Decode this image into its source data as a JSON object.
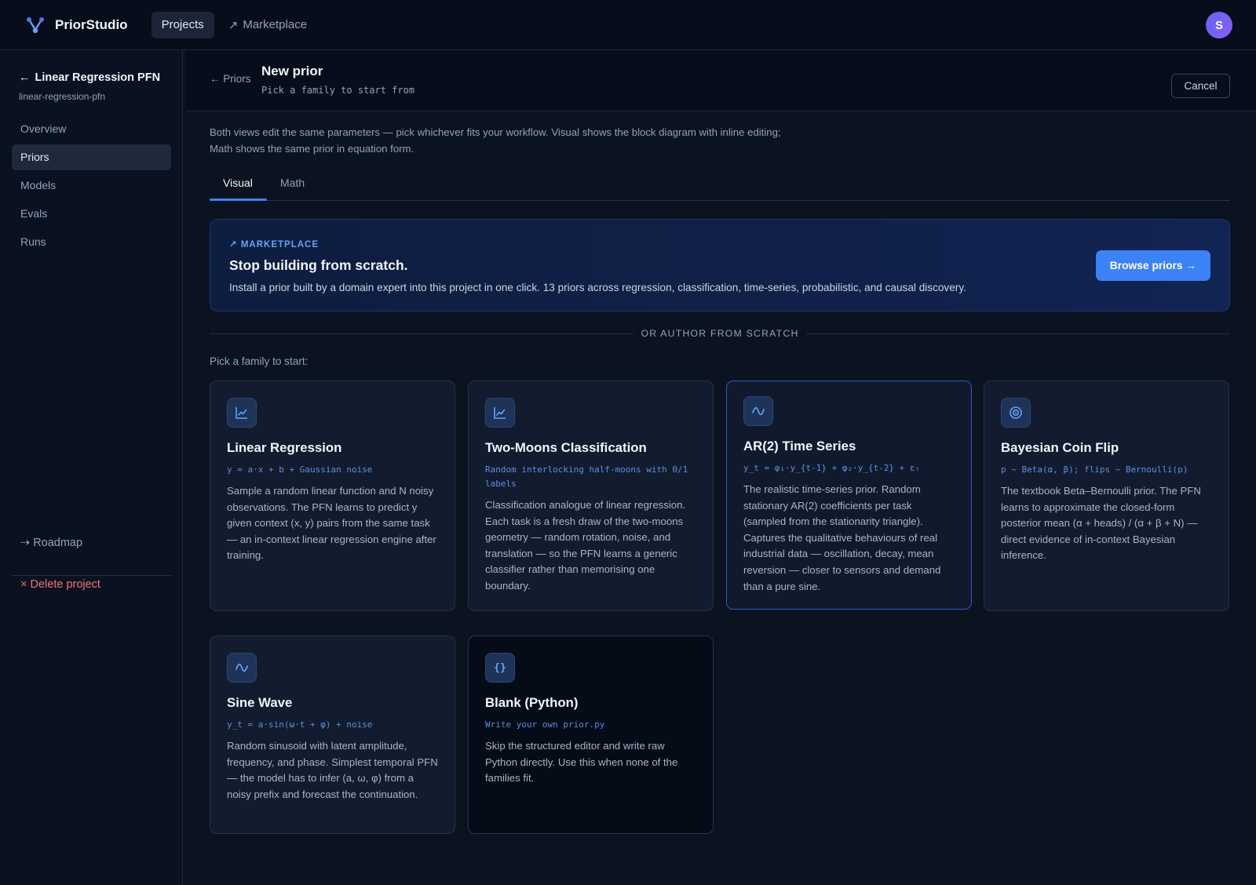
{
  "app": {
    "name": "PriorStudio",
    "nav": {
      "projects": "Projects",
      "marketplace": "Marketplace"
    },
    "user_initial": "S"
  },
  "sidebar": {
    "project_title": "Linear Regression PFN",
    "project_slug": "linear-regression-pfn",
    "items": [
      {
        "label": "Overview"
      },
      {
        "label": "Priors"
      },
      {
        "label": "Models"
      },
      {
        "label": "Evals"
      },
      {
        "label": "Runs"
      }
    ],
    "roadmap": "Roadmap",
    "delete": "Delete project"
  },
  "header": {
    "back": "Priors",
    "title": "New prior",
    "subtitle": "Pick a family to start from",
    "cancel": "Cancel"
  },
  "intro": "Both views edit the same parameters — pick whichever fits your workflow. Visual shows the block diagram with inline editing; Math shows the same prior in equation form.",
  "tabs": [
    {
      "label": "Visual"
    },
    {
      "label": "Math"
    }
  ],
  "marketplace": {
    "kicker": "MARKETPLACE",
    "title": "Stop building from scratch.",
    "description": "Install a prior built by a domain expert into this project in one click. 13 priors across regression, classification, time-series, probabilistic, and causal discovery.",
    "button": "Browse priors →"
  },
  "divider_text": "OR AUTHOR FROM SCRATCH",
  "pick_label": "Pick a family to start:",
  "families": [
    {
      "title": "Linear Regression",
      "formula": "y = a·x + b + Gaussian noise",
      "description": "Sample a random linear function and N noisy observations. The PFN learns to predict y given context (x, y) pairs from the same task — an in-context linear regression engine after training."
    },
    {
      "title": "Two-Moons Classification",
      "formula": "Random interlocking half-moons with 0/1 labels",
      "description": "Classification analogue of linear regression. Each task is a fresh draw of the two-moons geometry — random rotation, noise, and translation — so the PFN learns a generic classifier rather than memorising one boundary."
    },
    {
      "title": "AR(2) Time Series",
      "formula": "y_t = φ₁·y_{t-1} + φ₂·y_{t-2} + εₜ",
      "description": "The realistic time-series prior. Random stationary AR(2) coefficients per task (sampled from the stationarity triangle). Captures the qualitative behaviours of real industrial data — oscillation, decay, mean reversion — closer to sensors and demand than a pure sine."
    },
    {
      "title": "Bayesian Coin Flip",
      "formula": "p ~ Beta(α, β); flips ~ Bernoulli(p)",
      "description": "The textbook Beta–Bernoulli prior. The PFN learns to approximate the closed-form posterior mean (α + heads) / (α + β + N) — direct evidence of in-context Bayesian inference."
    },
    {
      "title": "Sine Wave",
      "formula": "y_t = a·sin(ω·t + φ) + noise",
      "description": "Random sinusoid with latent amplitude, frequency, and phase. Simplest temporal PFN — the model has to infer (a, ω, φ) from a noisy prefix and forecast the continuation."
    },
    {
      "title": "Blank (Python)",
      "formula": "Write your own prior.py",
      "description": "Skip the structured editor and write raw Python directly. Use this when none of the families fit."
    }
  ],
  "colors": {
    "accent": "#3b82f6",
    "formula": "#5b8fe0",
    "danger": "#f87171",
    "background": "#0b1220"
  }
}
